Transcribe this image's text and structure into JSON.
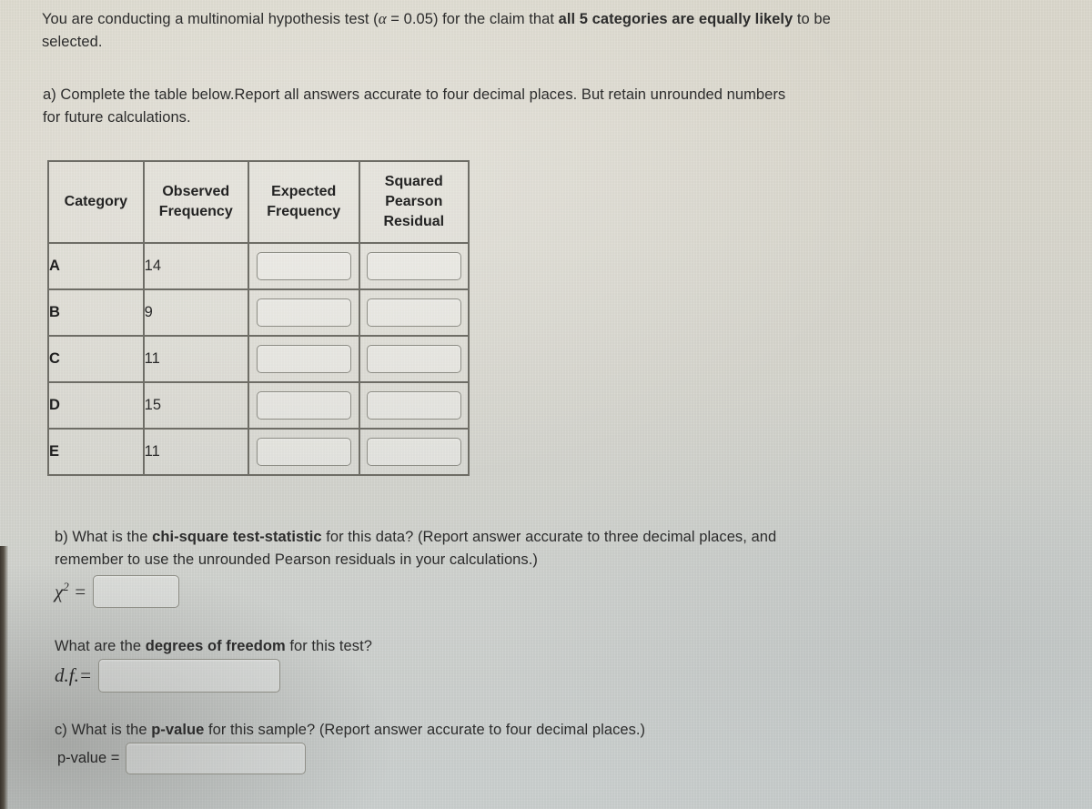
{
  "problem": {
    "intro_pre": "You are conducting a multinomial hypothesis test (",
    "alpha_symbol": "α",
    "intro_alpha_value": " = 0.05) for the claim that ",
    "intro_bold": "all 5 categories are equally likely",
    "intro_post": " to be selected.",
    "part_a": "a) Complete the table below.Report all answers accurate to four decimal places. But retain unrounded numbers for future calculations."
  },
  "table": {
    "headers": {
      "category": "Category",
      "observed": "Observed Frequency",
      "observed_line1": "Observed",
      "observed_line2": "Frequency",
      "expected_line1": "Expected",
      "expected_line2": "Frequency",
      "squared_line1": "Squared",
      "squared_line2": "Pearson",
      "squared_line3": "Residual"
    },
    "rows": [
      {
        "category": "A",
        "observed": "14",
        "expected": "",
        "squared_pearson_residual": ""
      },
      {
        "category": "B",
        "observed": "9",
        "expected": "",
        "squared_pearson_residual": ""
      },
      {
        "category": "C",
        "observed": "11",
        "expected": "",
        "squared_pearson_residual": ""
      },
      {
        "category": "D",
        "observed": "15",
        "expected": "",
        "squared_pearson_residual": ""
      },
      {
        "category": "E",
        "observed": "11",
        "expected": "",
        "squared_pearson_residual": ""
      }
    ]
  },
  "part_b": {
    "question_pre": "b) What is the ",
    "question_bold": "chi-square test-statistic",
    "question_post": " for this data? (Report answer accurate to three decimal places, and remember to use the unrounded Pearson residuals in your calculations.)",
    "chi_label_base": "χ",
    "chi_label_exponent": "2",
    "equals": "=",
    "chi_value": ""
  },
  "part_df": {
    "question_pre": "What are the ",
    "question_bold": "degrees of freedom",
    "question_post": " for this test?",
    "df_label": "d.f.=",
    "df_value": ""
  },
  "part_c": {
    "question_pre": "c) What is the ",
    "question_bold": "p-value",
    "question_post": " for this sample? (Report answer accurate to four decimal places.)",
    "pvalue_label": "p-value =",
    "pvalue_value": ""
  }
}
